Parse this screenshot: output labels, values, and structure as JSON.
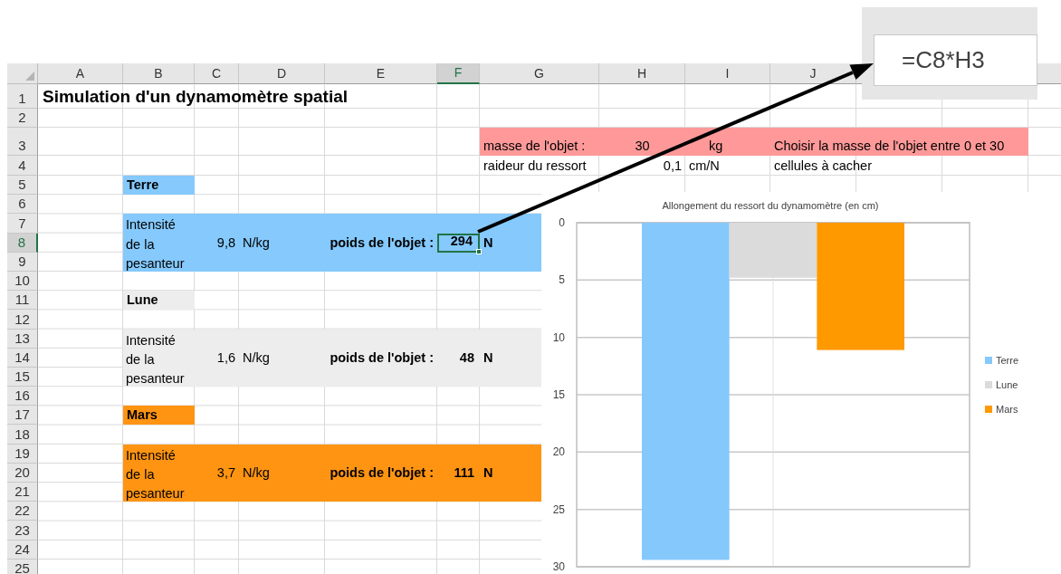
{
  "columns": [
    {
      "label": "A",
      "selected": false
    },
    {
      "label": "B",
      "selected": false
    },
    {
      "label": "C",
      "selected": false
    },
    {
      "label": "D",
      "selected": false
    },
    {
      "label": "E",
      "selected": false
    },
    {
      "label": "F",
      "selected": true
    },
    {
      "label": "G",
      "selected": false
    },
    {
      "label": "H",
      "selected": false
    },
    {
      "label": "I",
      "selected": false
    },
    {
      "label": "J",
      "selected": false
    }
  ],
  "rows": [
    {
      "label": "1",
      "selected": false
    },
    {
      "label": "2",
      "selected": false
    },
    {
      "label": "3",
      "selected": false
    },
    {
      "label": "4",
      "selected": false
    },
    {
      "label": "5",
      "selected": false
    },
    {
      "label": "6",
      "selected": false
    },
    {
      "label": "7",
      "selected": false
    },
    {
      "label": "8",
      "selected": true
    },
    {
      "label": "9",
      "selected": false
    },
    {
      "label": "10",
      "selected": false
    },
    {
      "label": "11",
      "selected": false
    },
    {
      "label": "12",
      "selected": false
    },
    {
      "label": "13",
      "selected": false
    },
    {
      "label": "14",
      "selected": false
    },
    {
      "label": "15",
      "selected": false
    },
    {
      "label": "16",
      "selected": false
    },
    {
      "label": "17",
      "selected": false
    },
    {
      "label": "18",
      "selected": false
    },
    {
      "label": "19",
      "selected": false
    },
    {
      "label": "20",
      "selected": false
    },
    {
      "label": "21",
      "selected": false
    },
    {
      "label": "22",
      "selected": false
    },
    {
      "label": "23",
      "selected": false
    },
    {
      "label": "24",
      "selected": false
    },
    {
      "label": "25",
      "selected": false
    }
  ],
  "title": "Simulation d'un dynamomètre spatial",
  "parameters": [
    {
      "label": "masse de l'objet :",
      "value": "30",
      "unit": "kg",
      "note": "Choisir la masse de l'objet entre 0 et 30",
      "highlighted": true
    },
    {
      "label": "raideur du ressort",
      "value": "0,1",
      "unit": "cm/N",
      "note": "cellules à cacher",
      "highlighted": false
    }
  ],
  "planets": [
    {
      "name": "Terre",
      "color": "#85c9fd",
      "gravity_label": "Intensité de la pesanteur",
      "gravity": "9,8",
      "gravity_unit": "N/kg",
      "weight_label": "poids de l'objet :",
      "weight": "294",
      "weight_unit": "N",
      "selected": true
    },
    {
      "name": "Lune",
      "color": "#ededed",
      "gravity_label": "Intensité de la pesanteur",
      "gravity": "1,6",
      "gravity_unit": "N/kg",
      "weight_label": "poids de l'objet :",
      "weight": "48",
      "weight_unit": "N",
      "selected": false
    },
    {
      "name": "Mars",
      "color": "#ff9412",
      "gravity_label": "Intensité de la pesanteur",
      "gravity": "3,7",
      "gravity_unit": "N/kg",
      "weight_label": "poids de l'objet :",
      "weight": "111",
      "weight_unit": "N",
      "selected": false
    }
  ],
  "chart": {
    "chart_data": {
      "type": "bar",
      "title": "Allongement du ressort du dynamomètre (en cm)",
      "series": [
        {
          "name": "Terre",
          "color": "#85c8fc",
          "values": [
            29.4
          ]
        },
        {
          "name": "Lune",
          "color": "#dbdbdb",
          "values": [
            4.8
          ]
        },
        {
          "name": "Mars",
          "color": "#ff9900",
          "values": [
            11.1
          ]
        }
      ],
      "ylim": [
        30,
        0
      ],
      "yticks": [
        {
          "value": 0,
          "label": "0"
        },
        {
          "value": 5,
          "label": "5"
        },
        {
          "value": 10,
          "label": "10"
        },
        {
          "value": 15,
          "label": "15"
        },
        {
          "value": 20,
          "label": "20"
        },
        {
          "value": 25,
          "label": "25"
        },
        {
          "value": 30,
          "label": "30"
        }
      ],
      "orientation": "vertical",
      "grid": true,
      "legend": true
    }
  },
  "formula_callout": {
    "formula": "=C8*H3"
  }
}
